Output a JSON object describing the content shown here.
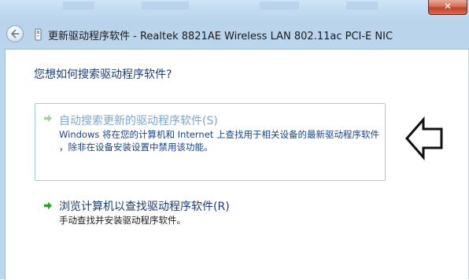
{
  "window": {
    "title": "更新驱动程序软件 - Realtek 8821AE Wireless LAN 802.11ac PCI-E NIC",
    "close_glyph": "✕"
  },
  "question": "您想如何搜索驱动程序软件?",
  "options": [
    {
      "title": "自动搜索更新的驱动程序软件(S)",
      "desc_line1": "Windows 将在您的计算机和 Internet 上查找用于相关设备的最新驱动程序软件",
      "desc_line2": "，除非在设备安装设置中禁用该功能。",
      "title_color": "#7aa6d1",
      "desc_color": "#15448a"
    },
    {
      "title": "浏览计算机以查找驱动程序软件(R)",
      "desc_line1": "手动查找并安装驱动程序软件。",
      "title_color": "#1b3c74",
      "desc_color": "#1b1b1b"
    }
  ],
  "icons": {
    "back": "back-arrow-icon",
    "device": "device-icon",
    "option_arrow": "green-arrow-icon",
    "pointer": "hollow-left-arrow-icon"
  },
  "colors": {
    "accent_green": "#27a81b",
    "frame_blue": "#bcd6ee",
    "close_red": "#c2412a"
  }
}
